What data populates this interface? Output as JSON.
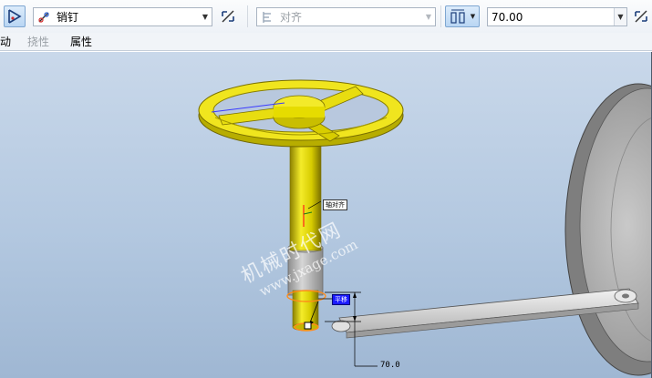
{
  "toolbar": {
    "constraint_type": "销钉",
    "constraint_placeholder": "对齐",
    "offset_value": "70.00"
  },
  "tabs": [
    {
      "label": "动",
      "enabled": true
    },
    {
      "label": "挠性",
      "enabled": false
    },
    {
      "label": "属性",
      "enabled": true
    }
  ],
  "viewport": {
    "axis_label": "轴对齐",
    "translation_label": "平移",
    "dimension_value": "70.0",
    "watermark_cn": "机械时代网",
    "watermark_url": "www.jxage.com"
  },
  "colors": {
    "part_yellow": "#e6dc00",
    "selection_orange": "#ff8c1a",
    "highlight_blue": "#1a1aff",
    "viewport_top": "#c9d8ea",
    "viewport_bottom": "#9fb7d3"
  },
  "icons": {
    "sketch_connection": "triangle-pin-icon",
    "pin_connection": "pin-icon",
    "flip": "flip-icon",
    "align": "align-icon",
    "offset": "offset-icon"
  }
}
